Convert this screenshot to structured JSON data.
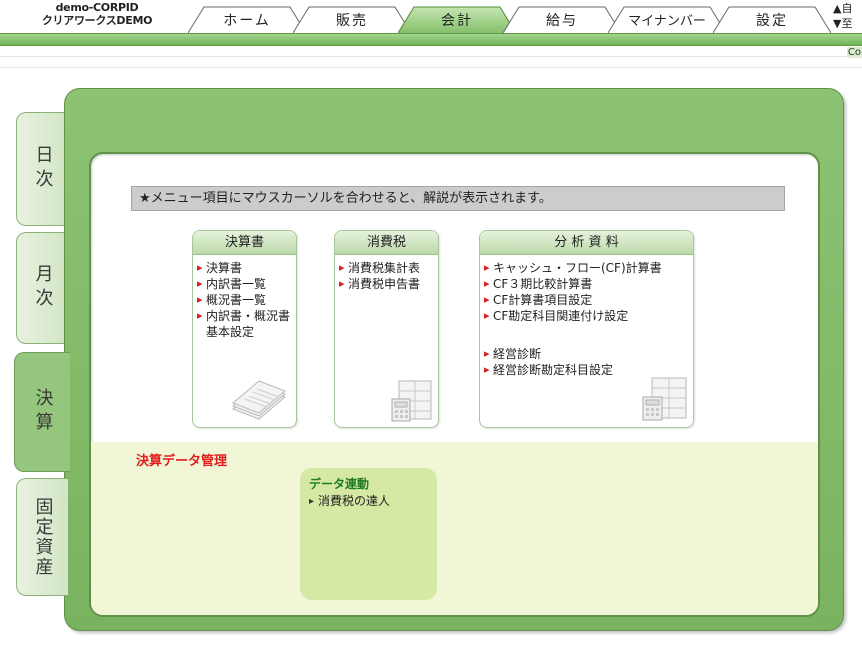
{
  "header": {
    "company_id": "demo-CORPID",
    "company_name": "クリアワークスDEMO",
    "tabs": [
      {
        "label": "ホーム",
        "active": false
      },
      {
        "label": "販売",
        "active": false
      },
      {
        "label": "会計",
        "active": true
      },
      {
        "label": "給与",
        "active": false
      },
      {
        "label": "マイナンバー",
        "active": false
      },
      {
        "label": "設定",
        "active": false
      }
    ],
    "side_links": [
      "▲自",
      "▼至"
    ],
    "copyright_fragment": "Co"
  },
  "sidebar": {
    "tabs": [
      {
        "label": "日次",
        "active": false
      },
      {
        "label": "月次",
        "active": false
      },
      {
        "label": "決算",
        "active": true
      },
      {
        "label": "固定資産",
        "active": false
      }
    ]
  },
  "notice": "★メニュー項目にマウスカーソルを合わせると、解説が表示されます。",
  "cards": {
    "kessansho": {
      "title": "決算書",
      "items": [
        "決算書",
        "内訳書一覧",
        "概況書一覧",
        "内訳書・概況書 基本設定"
      ]
    },
    "shohizei": {
      "title": "消費税",
      "items": [
        "消費税集計表",
        "消費税申告書"
      ]
    },
    "bunseki": {
      "title": "分 析 資 料",
      "items": [
        "キャッシュ・フロー(CF)計算書",
        "CF３期比較計算書",
        "CF計算書項目設定",
        "CF勘定科目関連付け設定"
      ],
      "items2": [
        "経営診断",
        "経営診断勘定科目設定"
      ]
    }
  },
  "data_management": {
    "title": "決算データ管理",
    "link_box_title": "データ連動",
    "link_box_items": [
      "消費税の達人"
    ]
  },
  "colors": {
    "accent_green": "#7ab35f",
    "bullet_red": "#d42020",
    "section_red": "#e41b1b",
    "link_green": "#1e7a23"
  }
}
